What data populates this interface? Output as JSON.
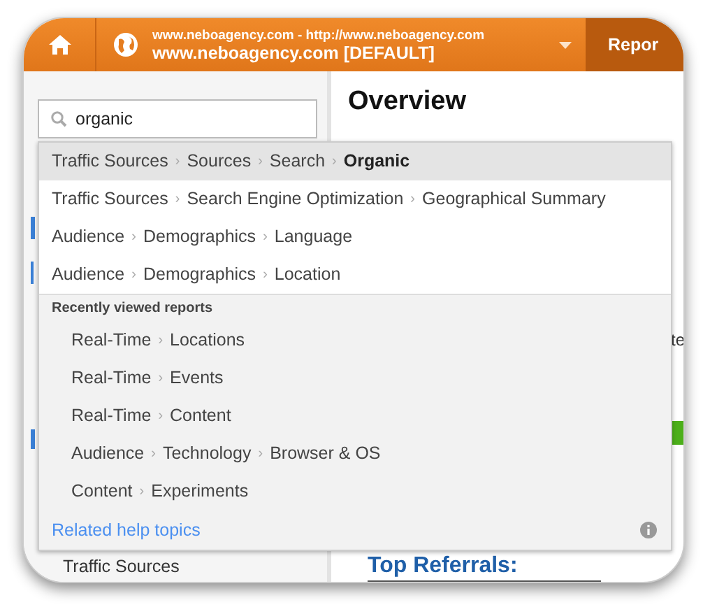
{
  "header": {
    "site_url": "www.neboagency.com - http://www.neboagency.com",
    "profile": "www.neboagency.com [DEFAULT]",
    "tab": "Repor"
  },
  "search": {
    "value": "organic"
  },
  "overview_title": "Overview",
  "separator": "›",
  "suggestions": [
    {
      "parts": [
        "Traffic Sources",
        "Sources",
        "Search",
        "Organic"
      ],
      "selected": true
    },
    {
      "parts": [
        "Traffic Sources",
        "Search Engine Optimization",
        "Geographical Summary"
      ],
      "selected": false
    },
    {
      "parts": [
        "Audience",
        "Demographics",
        "Language"
      ],
      "selected": false
    },
    {
      "parts": [
        "Audience",
        "Demographics",
        "Location"
      ],
      "selected": false
    }
  ],
  "recent_heading": "Recently viewed reports",
  "recent": [
    {
      "parts": [
        "Real-Time",
        "Locations"
      ]
    },
    {
      "parts": [
        "Real-Time",
        "Events"
      ]
    },
    {
      "parts": [
        "Real-Time",
        "Content"
      ]
    },
    {
      "parts": [
        "Audience",
        "Technology",
        "Browser & OS"
      ]
    },
    {
      "parts": [
        "Content",
        "Experiments"
      ]
    }
  ],
  "help_link": "Related help topics",
  "sidebar_item": "Traffic Sources",
  "content_fragment": "te",
  "top_referrals": "Top Referrals:"
}
